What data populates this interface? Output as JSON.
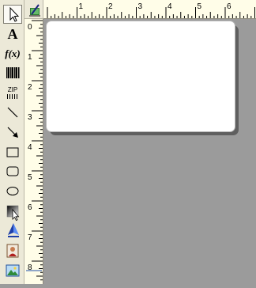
{
  "toolbar": {
    "tools": [
      {
        "id": "pointer",
        "name": "pointer-tool",
        "icon": "arrow-pointer-icon",
        "glyph": "",
        "selected": true
      },
      {
        "id": "text",
        "name": "text-tool",
        "icon": "text-a-icon",
        "glyph": "A",
        "selected": false
      },
      {
        "id": "function",
        "name": "function-tool",
        "icon": "function-fx-icon",
        "glyph": "f(x)",
        "selected": false
      },
      {
        "id": "barcode",
        "name": "barcode-tool",
        "icon": "barcode-icon",
        "glyph": "",
        "selected": false
      },
      {
        "id": "zip",
        "name": "zip-barcode-tool",
        "icon": "zip-barcode-icon",
        "glyph": "ZIP",
        "selected": false
      },
      {
        "id": "line",
        "name": "line-tool",
        "icon": "line-icon",
        "glyph": "",
        "selected": false
      },
      {
        "id": "arrow",
        "name": "arrow-tool",
        "icon": "arrow-line-icon",
        "glyph": "",
        "selected": false
      },
      {
        "id": "rectangle",
        "name": "rectangle-tool",
        "icon": "rectangle-icon",
        "glyph": "",
        "selected": false
      },
      {
        "id": "rounded-rectangle",
        "name": "rounded-rectangle-tool",
        "icon": "rounded-rectangle-icon",
        "glyph": "",
        "selected": false
      },
      {
        "id": "ellipse",
        "name": "ellipse-tool",
        "icon": "ellipse-icon",
        "glyph": "",
        "selected": false
      },
      {
        "id": "gradient",
        "name": "gradient-tool",
        "icon": "gradient-icon",
        "glyph": "",
        "selected": false
      },
      {
        "id": "shape-fill",
        "name": "shape-fill-tool",
        "icon": "triangle-shape-icon",
        "glyph": "",
        "selected": false
      },
      {
        "id": "photo",
        "name": "photo-tool",
        "icon": "photo-portrait-icon",
        "glyph": "",
        "selected": false
      },
      {
        "id": "image",
        "name": "image-tool",
        "icon": "landscape-image-icon",
        "glyph": "",
        "selected": false
      }
    ]
  },
  "rulers": {
    "corner_icon": "ruler-settings-icon",
    "horizontal_labels": [
      "1",
      "2",
      "3",
      "4",
      "5",
      "6"
    ],
    "vertical_labels": [
      "0",
      "1",
      "2",
      "3",
      "4",
      "5",
      "6",
      "7",
      "8"
    ]
  },
  "canvas": {
    "background": "#9b9b9b",
    "label_color": "#ffffff",
    "label_shadow": "#5f5f5f"
  }
}
